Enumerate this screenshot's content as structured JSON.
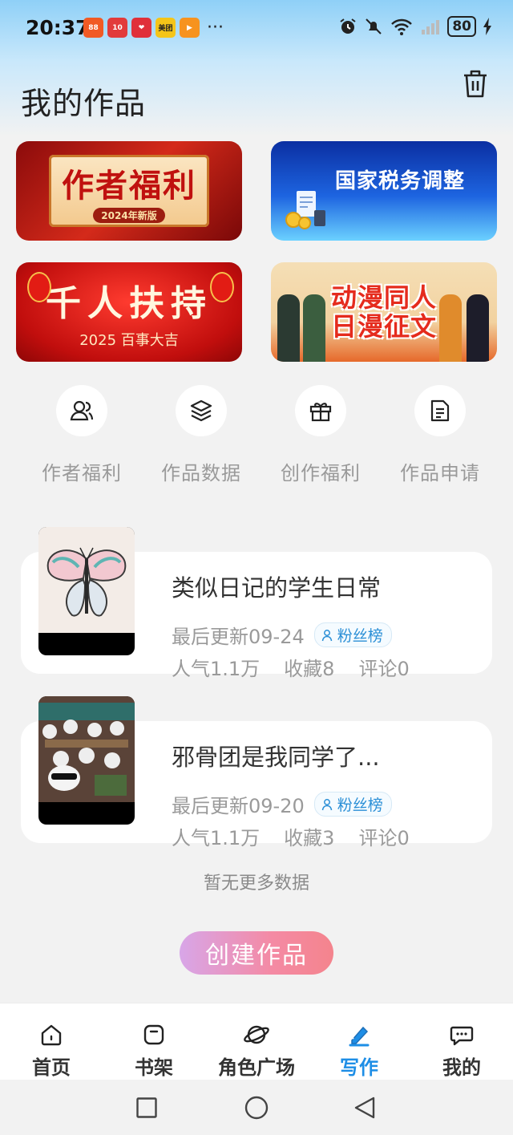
{
  "status_bar": {
    "time": "20:37",
    "battery": "80",
    "app_icons": [
      {
        "name": "app-icon-1",
        "color": "#f15a24",
        "text": "88"
      },
      {
        "name": "app-icon-2",
        "color": "#e23b3b",
        "text": "10"
      },
      {
        "name": "app-icon-3",
        "color": "#e0303a",
        "text": ""
      },
      {
        "name": "app-icon-meituan",
        "color": "#f5c518",
        "text": "美团"
      },
      {
        "name": "app-icon-5",
        "color": "#f7931e",
        "text": "▶"
      }
    ]
  },
  "header": {
    "title": "我的作品"
  },
  "banners": [
    {
      "title": "作者福利",
      "subtitle": "2024年新版"
    },
    {
      "title": "国家税务调整"
    },
    {
      "title": "千人扶持",
      "subtitle": "2025 百事大吉"
    },
    {
      "title_line1": "动漫同人",
      "title_line2": "日漫征文"
    }
  ],
  "quick_entries": [
    {
      "label": "作者福利",
      "icon": "author-users-icon"
    },
    {
      "label": "作品数据",
      "icon": "layers-icon"
    },
    {
      "label": "创作福利",
      "icon": "gift-icon"
    },
    {
      "label": "作品申请",
      "icon": "document-icon"
    }
  ],
  "works": [
    {
      "title": "类似日记的学生日常",
      "updated": "最后更新09-24",
      "badge": "粉丝榜",
      "popularity": "人气1.1万",
      "favorites": "收藏8",
      "comments": "评论0"
    },
    {
      "title": "邪骨团是我同学了...",
      "updated": "最后更新09-20",
      "badge": "粉丝榜",
      "popularity": "人气1.1万",
      "favorites": "收藏3",
      "comments": "评论0"
    }
  ],
  "footer_note": "暂无更多数据",
  "create_button": "创建作品",
  "tabs": [
    {
      "label": "首页",
      "icon": "home-icon"
    },
    {
      "label": "书架",
      "icon": "bookshelf-icon"
    },
    {
      "label": "角色广场",
      "icon": "planet-icon"
    },
    {
      "label": "写作",
      "icon": "pen-icon",
      "active": true
    },
    {
      "label": "我的",
      "icon": "chat-icon"
    }
  ],
  "colors": {
    "accent": "#1e8ee6",
    "badge_text": "#2b8fd6"
  }
}
